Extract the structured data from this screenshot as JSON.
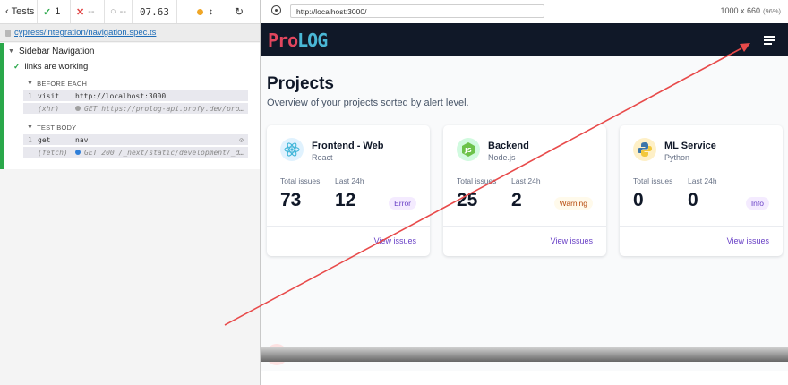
{
  "runner": {
    "tests_label": "Tests",
    "passed": "1",
    "failed": "--",
    "pending": "--",
    "duration": "07.63",
    "spec_path": "cypress/integration/navigation.spec.ts",
    "suite_title": "Sidebar Navigation",
    "test_title": "links are working",
    "before_each_label": "BEFORE EACH",
    "test_body_label": "TEST BODY",
    "commands": [
      {
        "num": "1",
        "name": "visit",
        "msg": "http://localhost:3000"
      },
      {
        "num": "",
        "name": "(xhr)",
        "msg": "GET https://prolog-api.profy.dev/proj…"
      },
      {
        "num": "1",
        "name": "get",
        "msg": "nav"
      },
      {
        "num": "",
        "name": "(fetch)",
        "msg": "GET 200 /_next/static/development/_de…"
      }
    ],
    "colors": {
      "pass": "#2aa84a",
      "fail": "#e04444",
      "running": "#f0a626",
      "xhr_dot": "#a0a0a0",
      "fetch_dot": "#2f7fd8"
    }
  },
  "aut": {
    "url": "http://localhost:3000/",
    "viewport": "1000 x 660",
    "zoom": "(96%)",
    "app": {
      "logo_part1": "Pro",
      "logo_part2": "LOG",
      "page_title": "Projects",
      "page_subtitle": "Overview of your projects sorted by alert level.",
      "total_label": "Total issues",
      "last24_label": "Last 24h",
      "link_label": "View issues",
      "projects": [
        {
          "name": "Frontend - Web",
          "language": "React",
          "total": "73",
          "last24": "12",
          "status": "Error",
          "icon": "react-icon",
          "status_color": "#6941c6",
          "status_bg": "#f4ebff"
        },
        {
          "name": "Backend",
          "language": "Node.js",
          "total": "25",
          "last24": "2",
          "status": "Warning",
          "icon": "nodejs-icon",
          "status_color": "#b54708",
          "status_bg": "#fffaeb"
        },
        {
          "name": "ML Service",
          "language": "Python",
          "total": "0",
          "last24": "0",
          "status": "Info",
          "icon": "python-icon",
          "status_color": "#6941c6",
          "status_bg": "#f4ebff"
        }
      ]
    }
  },
  "annotation": {
    "arrow_color": "#e84a4a"
  }
}
